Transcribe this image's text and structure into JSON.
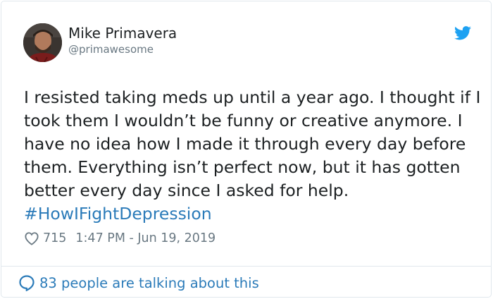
{
  "user": {
    "display_name": "Mike Primavera",
    "screen_name": "@primawesome"
  },
  "tweet": {
    "text": "I resisted taking meds up until a year ago. I thought if I took them I wouldn’t be funny or creative anymore. I have no idea how I made it through every day before them. Everything isn’t perfect now, but it has gotten better every day since I asked for help. ",
    "hashtag": "#HowIFightDepression"
  },
  "meta": {
    "like_count": "715",
    "timestamp": "1:47 PM - Jun 19, 2019"
  },
  "footer": {
    "conversation_label": "83 people are talking about this"
  },
  "colors": {
    "link": "#2b7bb9",
    "twitter_blue": "#1da1f2",
    "muted": "#697882",
    "text": "#1c2022",
    "border": "#e1e8ed"
  },
  "icons": {
    "brand": "twitter-bird-icon",
    "like": "heart-icon",
    "conversation": "speech-bubble-icon"
  }
}
